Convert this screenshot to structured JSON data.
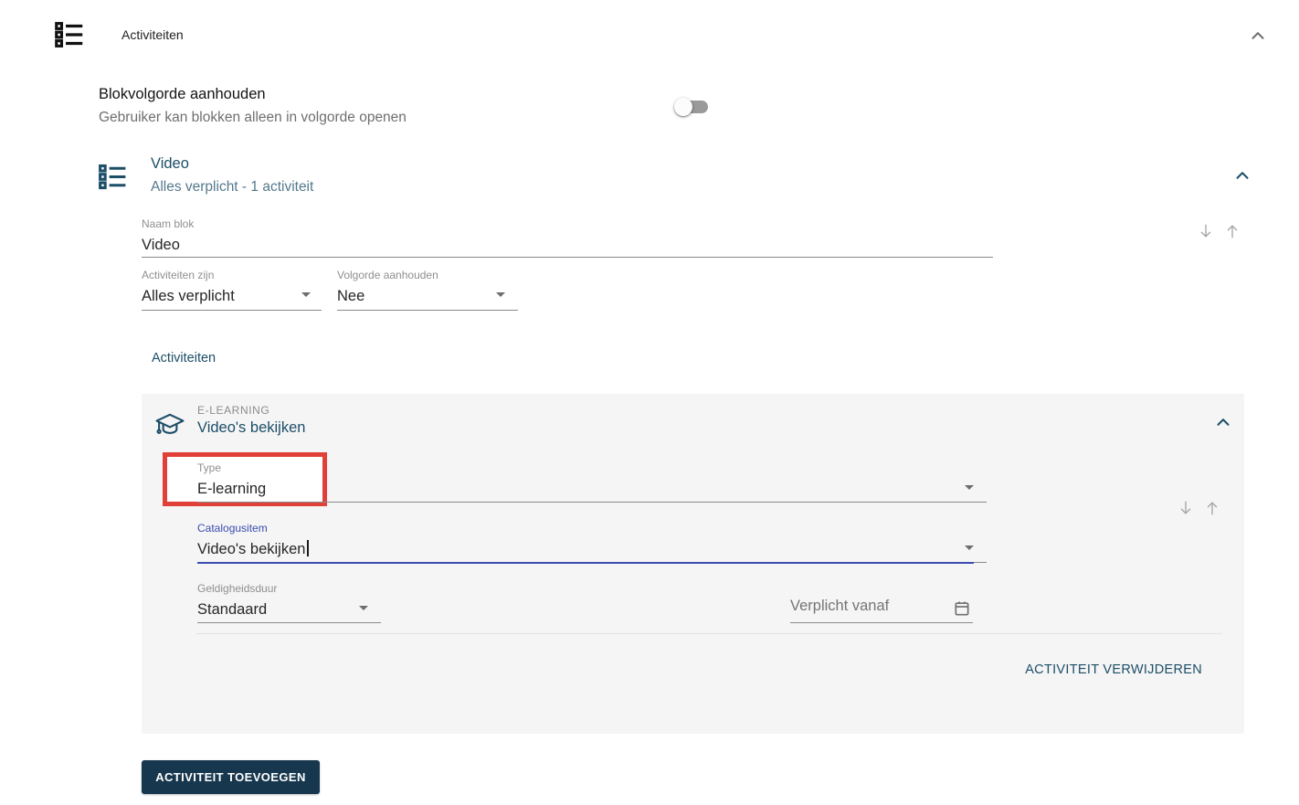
{
  "colors": {
    "navy": "#1d4e68",
    "navy_muted": "#54788c",
    "button_bg": "#17374e",
    "focus_indigo": "#3b4db0",
    "annotation_red": "#e04038",
    "card_bg": "#f5f5f5"
  },
  "header": {
    "title": "Activiteiten",
    "icon": "list-icon",
    "collapse_icon": "chevron-up-icon"
  },
  "block_order_toggle": {
    "label": "Blokvolgorde aanhouden",
    "description": "Gebruiker kan blokken alleen in volgorde openen",
    "state": "off"
  },
  "block": {
    "icon": "list-icon",
    "title": "Video",
    "subtitle": "Alles verplicht - 1 activiteit",
    "name_field": {
      "label": "Naam blok",
      "value": "Video"
    },
    "required_select": {
      "label": "Activiteiten zijn",
      "value": "Alles verplicht"
    },
    "order_select": {
      "label": "Volgorde aanhouden",
      "value": "Nee"
    },
    "activities_heading": "Activiteiten"
  },
  "activity_card": {
    "icon": "graduation-cap-icon",
    "category": "E-LEARNING",
    "title": "Video's bekijken",
    "type_select": {
      "label": "Type",
      "value": "E-learning",
      "highlighted": true
    },
    "catalog_select": {
      "label": "Catalogusitem",
      "value": "Video's bekijken",
      "focused": true
    },
    "validity_select": {
      "label": "Geldigheidsduur",
      "value": "Standaard"
    },
    "required_from_field": {
      "placeholder": "Verplicht vanaf",
      "icon": "calendar-icon"
    },
    "remove_button_label": "ACTIVITEIT VERWIJDEREN"
  },
  "footer": {
    "add_activity_label": "ACTIVITEIT TOEVOEGEN"
  }
}
